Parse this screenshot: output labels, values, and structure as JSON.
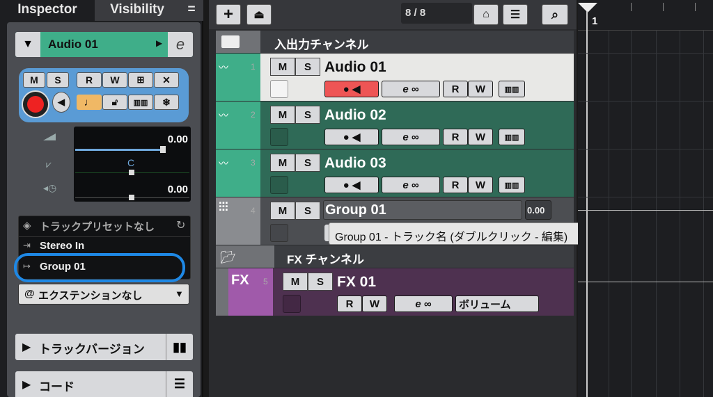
{
  "inspector": {
    "tabs": [
      "Inspector",
      "Visibility"
    ],
    "menu_icon": "hamburger-icon",
    "track_name": "Audio 01",
    "buttons": {
      "m": "M",
      "s": "S",
      "r": "R",
      "w": "W"
    },
    "volume": "0.00",
    "pan": "C",
    "delay": "0.00",
    "preset": "トラックプリセットなし",
    "input": "Stereo In",
    "output": "Group 01",
    "extension": "エクステンションなし",
    "track_versions": "トラックバージョン",
    "chord": "コード"
  },
  "toolbar": {
    "counter": "8 / 8"
  },
  "tracks": {
    "folder_io": "入出力チャンネル",
    "audio1": {
      "num": "1",
      "name": "Audio 01"
    },
    "audio2": {
      "num": "2",
      "name": "Audio 02"
    },
    "audio3": {
      "num": "3",
      "name": "Audio 03"
    },
    "group1": {
      "num": "4",
      "name": "Group 01",
      "vol": "0.00"
    },
    "folder_fx": "FX チャンネル",
    "fx1": {
      "num": "5",
      "name": "FX 01",
      "volume_label": "ボリューム",
      "badge": "FX"
    },
    "ms": {
      "m": "M",
      "s": "S"
    },
    "rw": {
      "r": "R",
      "w": "W"
    }
  },
  "tooltip": "Group 01 - トラック名 (ダブルクリック - 編集)",
  "timeline": {
    "bar": "1"
  },
  "colors": {
    "audio": "#2f6a57",
    "audio_selected": "#e8e8e6",
    "audio_strip": "#3fae89",
    "group": "#4c4e52",
    "fx": "#4e3150",
    "fx_strip": "#a05aaa",
    "highlight": "#1e88e5"
  }
}
